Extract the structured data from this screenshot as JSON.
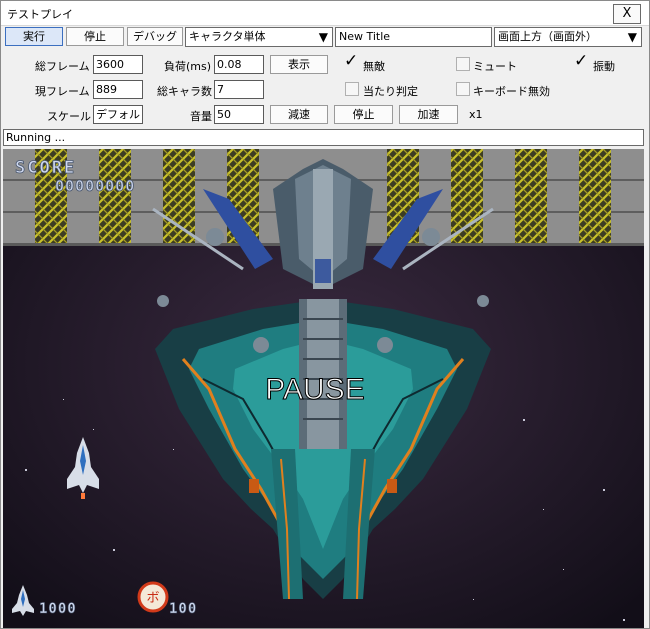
{
  "window": {
    "title": "テストプレイ",
    "close_label": "X"
  },
  "toolbar": {
    "run_label": "実行",
    "stop_label": "停止",
    "debug_label": "デバッグ",
    "char_select": "キャラクタ単体",
    "title_input": "New Title",
    "pos_select": "画面上方（画面外）",
    "dropdown_glyph": "▼"
  },
  "stats": {
    "total_frames_label": "総フレーム",
    "total_frames": "3600",
    "load_label": "負荷(ms)",
    "load": "0.08",
    "show_button": "表示",
    "current_frame_label": "現フレーム",
    "current_frame": "889",
    "char_count_label": "総キャラ数",
    "char_count": "7",
    "scale_label": "スケール",
    "scale": "デフォルト",
    "volume_label": "音量",
    "volume": "50",
    "slow_button": "減速",
    "pause_button": "停止",
    "fast_button": "加速",
    "speed": "x1"
  },
  "options": {
    "invincible": {
      "label": "無敵",
      "checked": true
    },
    "mute": {
      "label": "ミュート",
      "checked": false
    },
    "vibration": {
      "label": "振動",
      "checked": true
    },
    "hit_check": {
      "label": "当たり判定",
      "checked": false
    },
    "keyboard_off": {
      "label": "キーボード無効",
      "checked": false
    },
    "check_glyph": "✓"
  },
  "status": {
    "text": "Running ..."
  },
  "game": {
    "score_label": "SCORE",
    "score_value": "00000000",
    "pause_text": "PAUSE",
    "lives_value": "1000",
    "bombs_value": "100",
    "bomb_glyph": "ボ",
    "colors": {
      "hud": "#cfd8ee",
      "hazard": "#6a6a30",
      "teal": "#1f9e9a",
      "orange": "#e07a18"
    }
  }
}
